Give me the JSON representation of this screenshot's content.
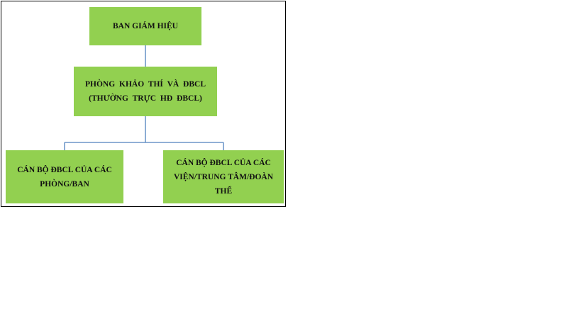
{
  "org_chart": {
    "top": {
      "label": "BAN GIÁM HIỆU"
    },
    "middle": {
      "line1": "PHÒNG KHẢO THÍ VÀ ĐBCL",
      "line2": "(THƯỜNG TRỰC HĐ ĐBCL)"
    },
    "left": {
      "label": "CÁN BỘ ĐBCL CỦA CÁC PHÒNG/BAN"
    },
    "right": {
      "label": "CÁN BỘ ĐBCL CỦA CÁC VIỆN/TRUNG TÂM/ĐOÀN THỂ"
    }
  },
  "colors": {
    "box_fill": "#92d050",
    "connector": "#4f81bd",
    "frame": "#000000"
  }
}
